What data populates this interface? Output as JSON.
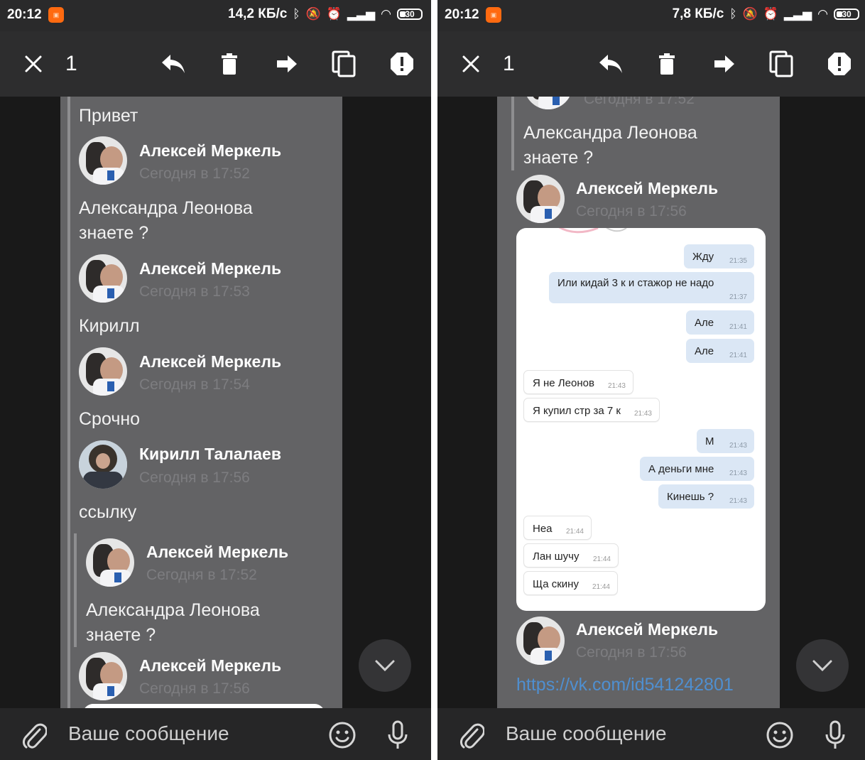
{
  "screens": [
    {
      "status": {
        "time": "20:12",
        "speed": "14,2 КБ/с",
        "battery": "30"
      },
      "toolbar": {
        "count": "1"
      },
      "messages": {
        "m1_text": "Привет",
        "m2_author": "Алексей Меркель",
        "m2_date": "Сегодня в 17:52",
        "m2_text_l1": "Александра Леонова",
        "m2_text_l2": "знаете ?",
        "m3_author": "Алексей Меркель",
        "m3_date": "Сегодня в 17:53",
        "m3_text": "Кирилл",
        "m4_author": "Алексей Меркель",
        "m4_date": "Сегодня в 17:54",
        "m4_text": "Срочно",
        "m5_author": "Кирилл Талалаев",
        "m5_date": "Сегодня в 17:56",
        "m5_text": "ссылку",
        "m6_author": "Алексей Меркель",
        "m6_date": "Сегодня в 17:52",
        "m6_text_l1": "Александра Леонова",
        "m6_text_l2": "знаете ?",
        "m7_author": "Алексей Меркель",
        "m7_date": "Сегодня в 17:56"
      },
      "input": {
        "placeholder": "Ваше сообщение"
      }
    },
    {
      "status": {
        "time": "20:12",
        "speed": "7,8 КБ/с",
        "battery": "30"
      },
      "toolbar": {
        "count": "1"
      },
      "messages": {
        "top_date": "Сегодня в 17:52",
        "q_text_l1": "Александра Леонова",
        "q_text_l2": "знаете ?",
        "a1_author": "Алексей Меркель",
        "a1_date": "Сегодня в 17:56",
        "a2_author": "Алексей Меркель",
        "a2_date": "Сегодня в 17:56",
        "link": "https://vk.com/id541242801"
      },
      "screenshot_chat": [
        {
          "dir": "out",
          "text": "Жду",
          "time": "21:35"
        },
        {
          "dir": "out",
          "text": "Или кидай 3 к и стажор не надо",
          "time": "21:37"
        },
        {
          "dir": "out",
          "text": "Але",
          "time": "21:41"
        },
        {
          "dir": "out",
          "text": "Але",
          "time": "21:41"
        },
        {
          "dir": "in",
          "text": "Я не Леонов",
          "time": "21:43"
        },
        {
          "dir": "in",
          "text": "Я купил стр за 7 к",
          "time": "21:43"
        },
        {
          "dir": "out",
          "text": "М",
          "time": "21:43"
        },
        {
          "dir": "out",
          "text": "А деньги мне",
          "time": "21:43"
        },
        {
          "dir": "out",
          "text": "Кинешь ?",
          "time": "21:43"
        },
        {
          "dir": "in",
          "text": "Неа",
          "time": "21:44"
        },
        {
          "dir": "in",
          "text": "Лан шучу",
          "time": "21:44"
        },
        {
          "dir": "in",
          "text": "Ща скину",
          "time": "21:44"
        }
      ],
      "input": {
        "placeholder": "Ваше сообщение"
      }
    }
  ],
  "colors": {
    "link": "#4f8fd0",
    "card_bg": "#636365",
    "out_bubble": "#dbe7f5"
  }
}
